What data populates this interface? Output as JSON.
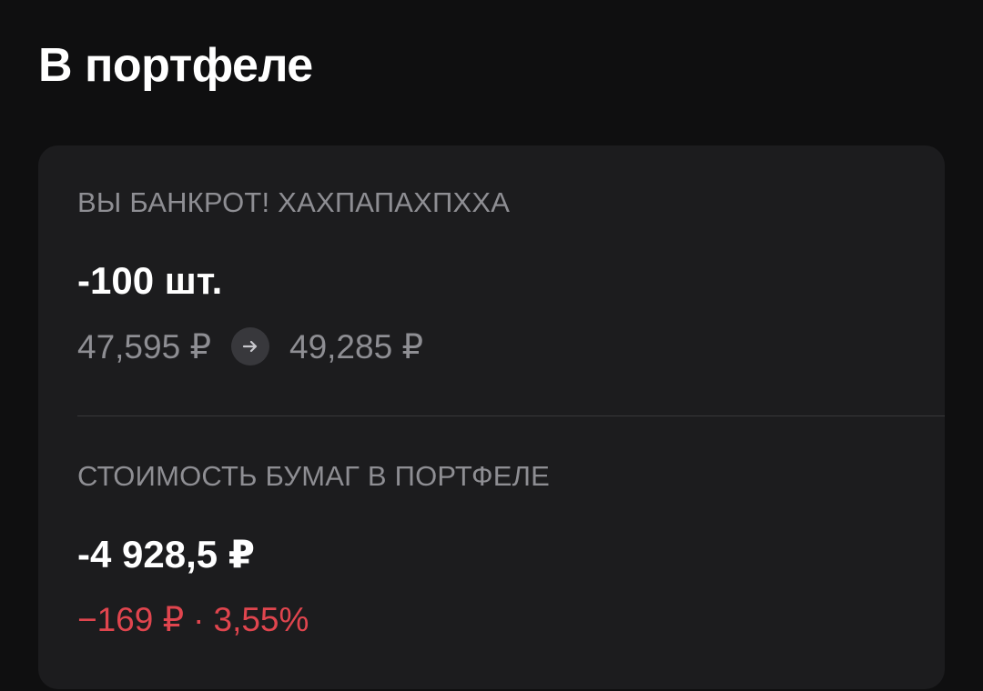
{
  "header": {
    "title": "В портфеле"
  },
  "position": {
    "caption": "ВЫ БАНКРОТ! ХАХПАПАХПХХА",
    "quantity": "-100 шт.",
    "price_from": "47,595 ₽",
    "price_to": "49,285 ₽",
    "arrow_icon": "arrow-right-icon"
  },
  "portfolio_value": {
    "caption": "СТОИМОСТЬ БУМАГ В ПОРТФЕЛЕ",
    "total": "-4 928,5 ₽",
    "change_amount": "−169 ₽",
    "separator": "·",
    "change_percent": "3,55%"
  },
  "colors": {
    "background": "#0f0f10",
    "card": "#1c1c1e",
    "secondary_text": "#8e8e93",
    "negative": "#e0454e"
  }
}
